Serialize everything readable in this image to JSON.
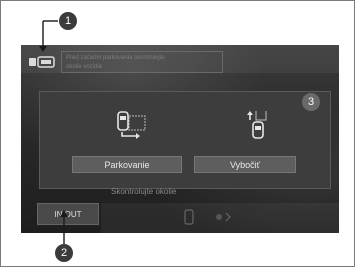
{
  "callouts": {
    "one": "1",
    "two": "2",
    "three": "3"
  },
  "top_message": {
    "line1": "Pred začatím parkovania skontrolujte",
    "line2": "okolie vozidla"
  },
  "dialog": {
    "parking_label": "Parkovanie",
    "exit_label": "Vybočiť"
  },
  "check_text": "Skontrolujte okolie",
  "inout_label": "IN/OUT",
  "colors": {
    "screen_bg": "#2a2a2a",
    "dialog_bg": "#3d3d3d",
    "button_bg": "#5e5e5e",
    "callout_bg": "#3b3b3b"
  },
  "icons": {
    "camera": "camera-icon",
    "parking": "parking-maneuver-icon",
    "exit": "exit-maneuver-icon"
  }
}
